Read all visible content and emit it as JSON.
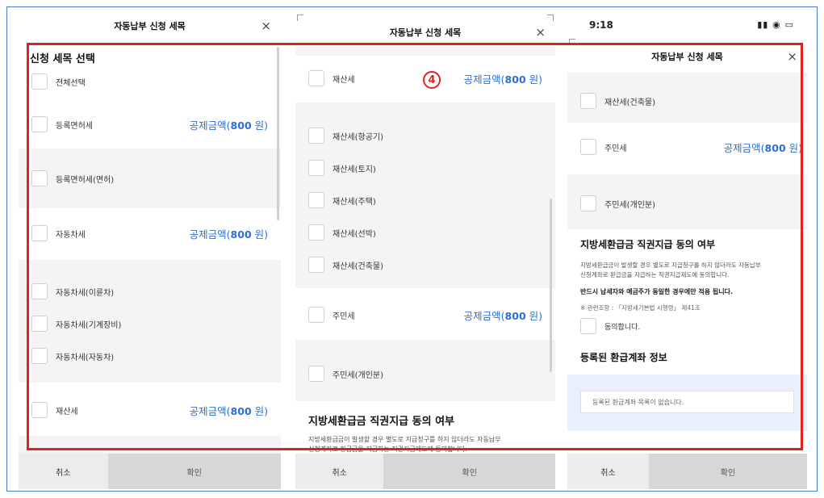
{
  "dialog": {
    "title": "자동납부 신청 세목",
    "cancel": "취소",
    "confirm": "확인",
    "close": "×"
  },
  "amount": {
    "prefix": "공제금액(",
    "value": "800",
    "suffix": " 원)"
  },
  "panel1": {
    "section_title": "신청 세목 선택",
    "select_all": "전체선택",
    "items": [
      "등록면허세",
      "등록면허세(면허)",
      "자동차세",
      "자동차세(이륜차)",
      "자동차세(기계장비)",
      "자동차세(자동차)",
      "재산세"
    ]
  },
  "panel2": {
    "items": [
      "재산세",
      "재산세(항공기)",
      "재산세(토지)",
      "재산세(주택)",
      "재산세(선박)",
      "재산세(건축물)",
      "주민세",
      "주민세(개인분)"
    ],
    "consent_title": "지방세환급금 직권지급 동의 여부",
    "consent_text1": "지방세환급금이 발생할 경우 별도로 지급청구를 하지 않더라도 자동납부",
    "consent_text2": "신청계좌로 환급금을 지급하는 직권지급제도에 동의합니다."
  },
  "panel3": {
    "status_time": "9:18",
    "status_icons": "▮▮ ◉ ▭",
    "items": [
      "재산세(건축물)",
      "주민세",
      "주민세(개인분)"
    ],
    "consent_title": "지방세환급금 직권지급 동의 여부",
    "consent_text1": "지방세환급금이 발생할 경우 별도로 지급청구를 하지 않더라도 자동납부",
    "consent_text2": "신청계좌로 환급금을 지급하는 직권지급제도에 동의합니다.",
    "consent_bold": "반드시 납세자와 예금주가 동일한 경우에만 적용 됩니다.",
    "related_law": "※  관련조항 : 「지방세기본법 시행령」 제41조",
    "agree": "동의합니다.",
    "account_title": "등록된 환급계좌 정보",
    "no_account": "등록된 환급계좌 목록이 없습니다."
  },
  "marker": "4",
  "colors": {
    "accent": "#2e6fd6",
    "highlight": "#e0211c",
    "frame": "#4a7bc4"
  }
}
